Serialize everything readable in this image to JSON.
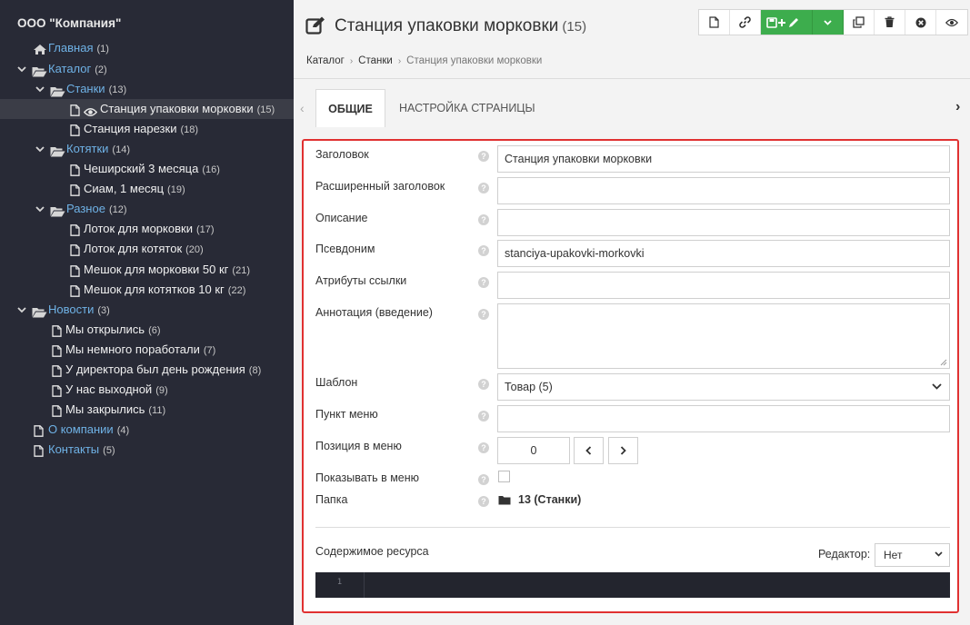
{
  "site": {
    "name": "ООО \"Компания\""
  },
  "tree": [
    {
      "label": "Главная",
      "count": "(1)",
      "kind": "home",
      "style": "link"
    },
    {
      "label": "Каталог",
      "count": "(2)",
      "kind": "folder-open",
      "style": "link",
      "expanded": true
    },
    {
      "label": "Станки",
      "count": "(13)",
      "kind": "folder-open",
      "style": "link",
      "expanded": true
    },
    {
      "label": "Станция упаковки морковки",
      "count": "(15)",
      "kind": "doc-eye",
      "style": "doc",
      "active": true
    },
    {
      "label": "Станция нарезки",
      "count": "(18)",
      "kind": "doc",
      "style": "doc"
    },
    {
      "label": "Котятки",
      "count": "(14)",
      "kind": "folder-open",
      "style": "link",
      "expanded": true
    },
    {
      "label": "Чеширский 3 месяца",
      "count": "(16)",
      "kind": "doc",
      "style": "doc"
    },
    {
      "label": "Сиам, 1 месяц",
      "count": "(19)",
      "kind": "doc",
      "style": "doc"
    },
    {
      "label": "Разное",
      "count": "(12)",
      "kind": "folder-open",
      "style": "link",
      "expanded": true
    },
    {
      "label": "Лоток для морковки",
      "count": "(17)",
      "kind": "doc",
      "style": "doc"
    },
    {
      "label": "Лоток для котяток",
      "count": "(20)",
      "kind": "doc",
      "style": "doc"
    },
    {
      "label": "Мешок для морковки 50 кг",
      "count": "(21)",
      "kind": "doc",
      "style": "doc"
    },
    {
      "label": "Мешок для котятков 10 кг",
      "count": "(22)",
      "kind": "doc",
      "style": "doc"
    },
    {
      "label": "Новости",
      "count": "(3)",
      "kind": "folder-open",
      "style": "link",
      "expanded": true
    },
    {
      "label": "Мы открылись",
      "count": "(6)",
      "kind": "doc",
      "style": "doc"
    },
    {
      "label": "Мы немного поработали",
      "count": "(7)",
      "kind": "doc",
      "style": "doc"
    },
    {
      "label": "У директора был день рождения",
      "count": "(8)",
      "kind": "doc",
      "style": "doc"
    },
    {
      "label": "У нас выходной",
      "count": "(9)",
      "kind": "doc",
      "style": "doc"
    },
    {
      "label": "Мы закрылись",
      "count": "(11)",
      "kind": "doc",
      "style": "doc"
    },
    {
      "label": "О компании",
      "count": "(4)",
      "kind": "doc",
      "style": "link"
    },
    {
      "label": "Контакты",
      "count": "(5)",
      "kind": "doc",
      "style": "link"
    }
  ],
  "header": {
    "title": "Станция упаковки морковки",
    "count": "(15)",
    "icon": "edit-icon"
  },
  "toolbar": {
    "icons": [
      "new-document-icon",
      "link-icon",
      "save-edit-icon",
      "chevron-down-icon",
      "duplicate-icon",
      "trash-icon",
      "close-circle-icon",
      "eye-icon"
    ]
  },
  "breadcrumb": {
    "items": [
      "Каталог",
      "Станки"
    ],
    "current": "Станция упаковки морковки"
  },
  "tabs": {
    "active": "Общие",
    "inactive": "Настройка страницы"
  },
  "form": {
    "title": {
      "label": "Заголовок",
      "value": "Станция упаковки морковки"
    },
    "longtitle": {
      "label": "Расширенный заголовок",
      "value": ""
    },
    "description": {
      "label": "Описание",
      "value": ""
    },
    "alias": {
      "label": "Псевдоним",
      "value": "stanciya-upakovki-morkovki"
    },
    "link_attributes": {
      "label": "Атрибуты ссылки",
      "value": ""
    },
    "introtext": {
      "label": "Аннотация (введение)",
      "value": ""
    },
    "template": {
      "label": "Шаблон",
      "value": "Товар (5)"
    },
    "menutitle": {
      "label": "Пункт меню",
      "value": ""
    },
    "menuindex": {
      "label": "Позиция в меню",
      "value": "0"
    },
    "hidemenu": {
      "label": "Показывать в меню",
      "checked": false
    },
    "parent": {
      "label": "Папка",
      "value": "13 (Станки)"
    },
    "content": {
      "label": "Содержимое ресурса",
      "editor_label": "Редактор:",
      "editor_value": "Нет",
      "line_number": "1"
    }
  },
  "colors": {
    "sidebar_bg": "#282a36",
    "link": "#6fb2e6",
    "accent_green": "#3dad4d",
    "highlight_border": "#e03131"
  }
}
